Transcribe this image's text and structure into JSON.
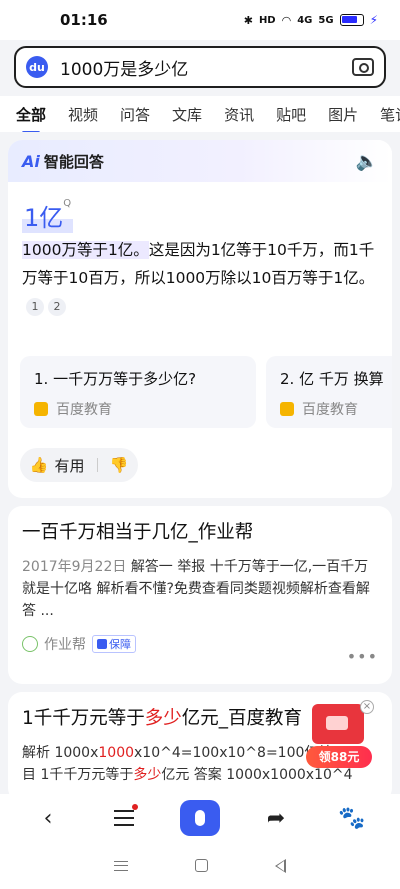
{
  "status_bar": {
    "time": "01:16",
    "icons": [
      "bluetooth-icon",
      "hd-icon",
      "wifi-icon",
      "signal-icon",
      "signal-icon",
      "battery-icon"
    ],
    "hd_label": "HD",
    "signal_1": "4G",
    "signal_2": "5G"
  },
  "search": {
    "query": "1000万是多少亿",
    "logo_text": "du"
  },
  "tabs": [
    "全部",
    "视频",
    "问答",
    "文库",
    "资讯",
    "贴吧",
    "图片",
    "笔记"
  ],
  "ai_card": {
    "title": "智能回答",
    "logo": "Ai",
    "answer": "1亿",
    "answer_mark": "Q",
    "body_lead": "1000万等于1亿。",
    "body_rest": "这是因为1亿等于10千万，而1千万等于10百万，所以1000万除以10百万等于1亿。",
    "refs": [
      "1",
      "2"
    ],
    "related": [
      {
        "title": "1. 一千万万等于多少亿?",
        "source": "百度教育"
      },
      {
        "title": "2. 亿 千万 换算",
        "source": "百度教育"
      }
    ],
    "like_label": "有用"
  },
  "results": [
    {
      "title": "一百千万相当于几亿_作业帮",
      "date": "2017年9月22日",
      "abstract": "解答一 举报 十千万等于一亿,一百千万就是十亿咯 解析看不懂?免费查看同类题视频解析查看解答 ...",
      "source": "作业帮",
      "badge": "保障"
    },
    {
      "title_pre": "1千千万元等于",
      "title_hl": "多少",
      "title_post": "亿元_百度教育",
      "abs_1": "解析 1000x",
      "abs_1_hl": "1000",
      "abs_1_post": "x10^4=100x10^8=100亿结",
      "abs_2_pre": "目 1千千万元等于",
      "abs_2_hl": "多少",
      "abs_2_post": "亿元 答案 1000x1000x10^4"
    }
  ],
  "promo": {
    "label": "领88元"
  },
  "colors": {
    "accent": "#3a5cf0",
    "highlight_red": "#e02020"
  }
}
